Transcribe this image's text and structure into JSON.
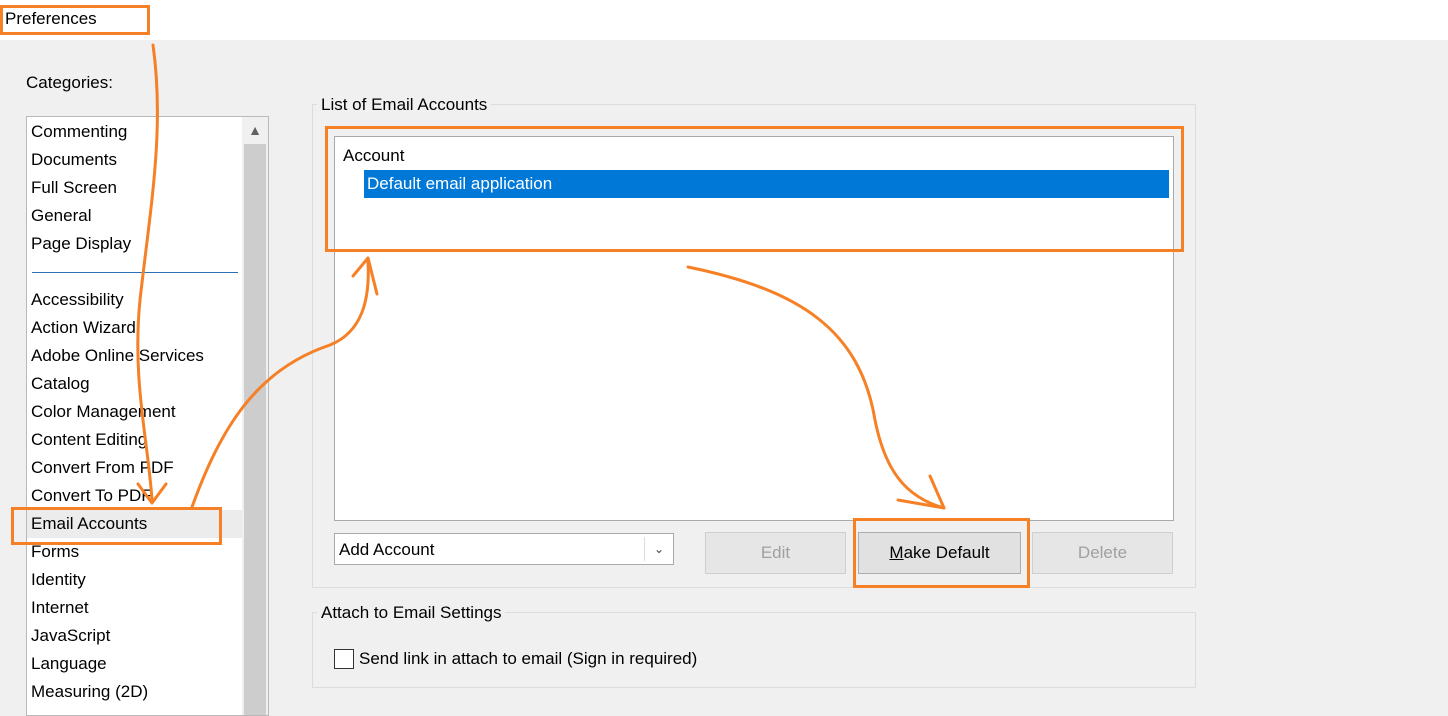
{
  "window": {
    "title": "Preferences"
  },
  "categories": {
    "label": "Categories:",
    "group1": [
      "Commenting",
      "Documents",
      "Full Screen",
      "General",
      "Page Display"
    ],
    "group2": [
      "Accessibility",
      "Action Wizard",
      "Adobe Online Services",
      "Catalog",
      "Color Management",
      "Content Editing",
      "Convert From PDF",
      "Convert To PDF",
      "Email Accounts",
      "Forms",
      "Identity",
      "Internet",
      "JavaScript",
      "Language",
      "Measuring (2D)"
    ],
    "selected": "Email Accounts"
  },
  "email_accounts": {
    "group_label": "List of Email Accounts",
    "column_header": "Account",
    "rows": [
      "Default email application"
    ],
    "add_account": {
      "value": "Add Account"
    },
    "buttons": {
      "edit": "Edit",
      "make_default": "Make Default",
      "delete": "Delete"
    }
  },
  "attach_settings": {
    "group_label": "Attach to Email Settings",
    "send_link_label": "Send link in attach to email (Sign in required)",
    "send_link_checked": false
  },
  "annotation_color": "#f58025",
  "selection_color": "#0078d7"
}
